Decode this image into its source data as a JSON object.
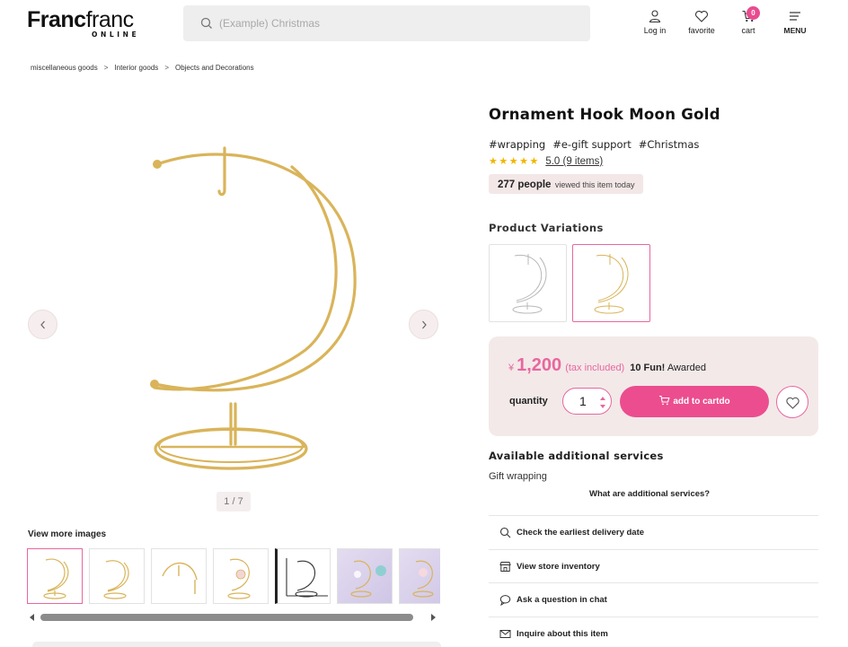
{
  "header": {
    "logo_main_bold": "Franc",
    "logo_main_light": "franc",
    "logo_sub": "ONLINE",
    "search_placeholder": "(Example) Christmas",
    "login_label": "Log in",
    "favorite_label": "favorite",
    "cart_label": "cart",
    "cart_count": "0",
    "menu_label": "MENU"
  },
  "breadcrumb": {
    "items": [
      "miscellaneous goods",
      "Interior goods",
      "Objects and Decorations"
    ],
    "separator": ">"
  },
  "gallery": {
    "counter": "1 / 7",
    "more_images_title": "View more images",
    "thumb_count_visible": 7
  },
  "product": {
    "title": "Ornament Hook Moon Gold",
    "tags": [
      "#wrapping",
      "#e-gift support",
      "#Christmas"
    ],
    "stars": "★★★★★",
    "rating_text": "5.0 (9 items)",
    "views_count": "277 people",
    "views_suffix": "viewed this item today",
    "variations_title": "Product Variations",
    "price_currency": "¥",
    "price": "1,200",
    "tax_label": "(tax included)",
    "fun_points": "10 Fun!",
    "fun_suffix": "Awarded",
    "quantity_label": "quantity",
    "quantity_value": "1",
    "add_to_cart_label": "add to cartdo"
  },
  "services": {
    "title": "Available additional services",
    "gift_wrapping": "Gift wrapping",
    "what_link": "What are additional services?",
    "items": [
      {
        "label": "Check the earliest delivery date",
        "icon": "search-icon"
      },
      {
        "label": "View store inventory",
        "icon": "store-icon"
      },
      {
        "label": "Ask a question in chat",
        "icon": "chat-icon"
      },
      {
        "label": "Inquire about this item",
        "icon": "mail-icon"
      }
    ]
  },
  "colors": {
    "accent_pink": "#ec4d8f",
    "gold": "#d9b45a",
    "price_box_bg": "#f3e9e9",
    "star": "#f1b500"
  }
}
